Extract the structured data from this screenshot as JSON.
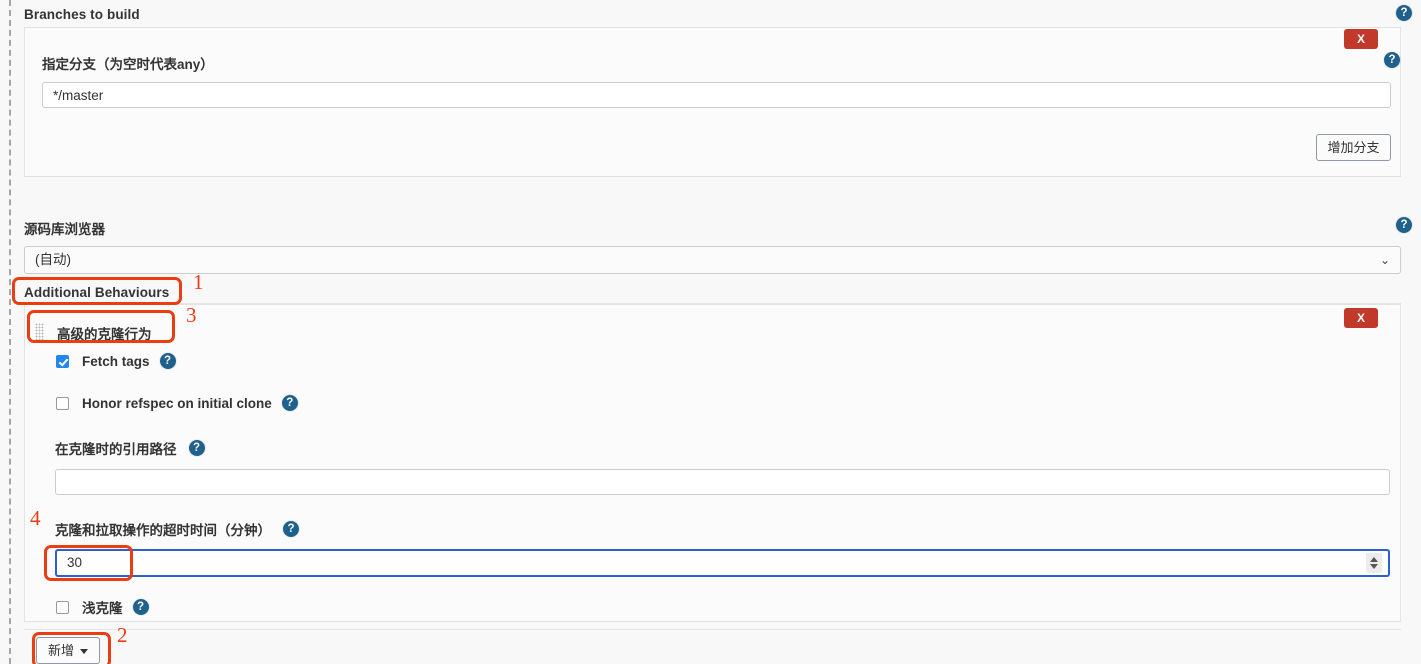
{
  "page": {
    "branches_section_label": "Branches to build",
    "repo_browser_label": "源码库浏览器",
    "repo_browser_value": "(自动)",
    "additional_behaviours_label": "Additional Behaviours"
  },
  "branches": {
    "field_label": "指定分支（为空时代表any）",
    "field_value": "*/master",
    "add_branch_button": "增加分支",
    "remove_label": "X"
  },
  "advanced_clone": {
    "title": "高级的克隆行为",
    "remove_label": "X",
    "fetch_tags_label": "Fetch tags",
    "honor_refspec_label": "Honor refspec on initial clone",
    "reference_path_label": "在克隆时的引用路径",
    "reference_path_value": "",
    "timeout_label": "克隆和拉取操作的超时时间（分钟）",
    "timeout_value": "30",
    "shallow_clone_label": "浅克隆"
  },
  "footer": {
    "add_button": "新增"
  },
  "icons": {
    "help": "?",
    "chevron_down": "⌄"
  },
  "annotations": [
    {
      "number": "1",
      "target": "additional-behaviours-label"
    },
    {
      "number": "2",
      "target": "add-button"
    },
    {
      "number": "3",
      "target": "advanced-clone-title"
    },
    {
      "number": "4",
      "target": "timeout-input"
    }
  ],
  "colors": {
    "accent_help": "#1f618d",
    "danger": "#c0392b",
    "annotation": "#ea3d11",
    "checkbox_checked": "#2286f0",
    "focus_border": "#2f5fcf"
  }
}
